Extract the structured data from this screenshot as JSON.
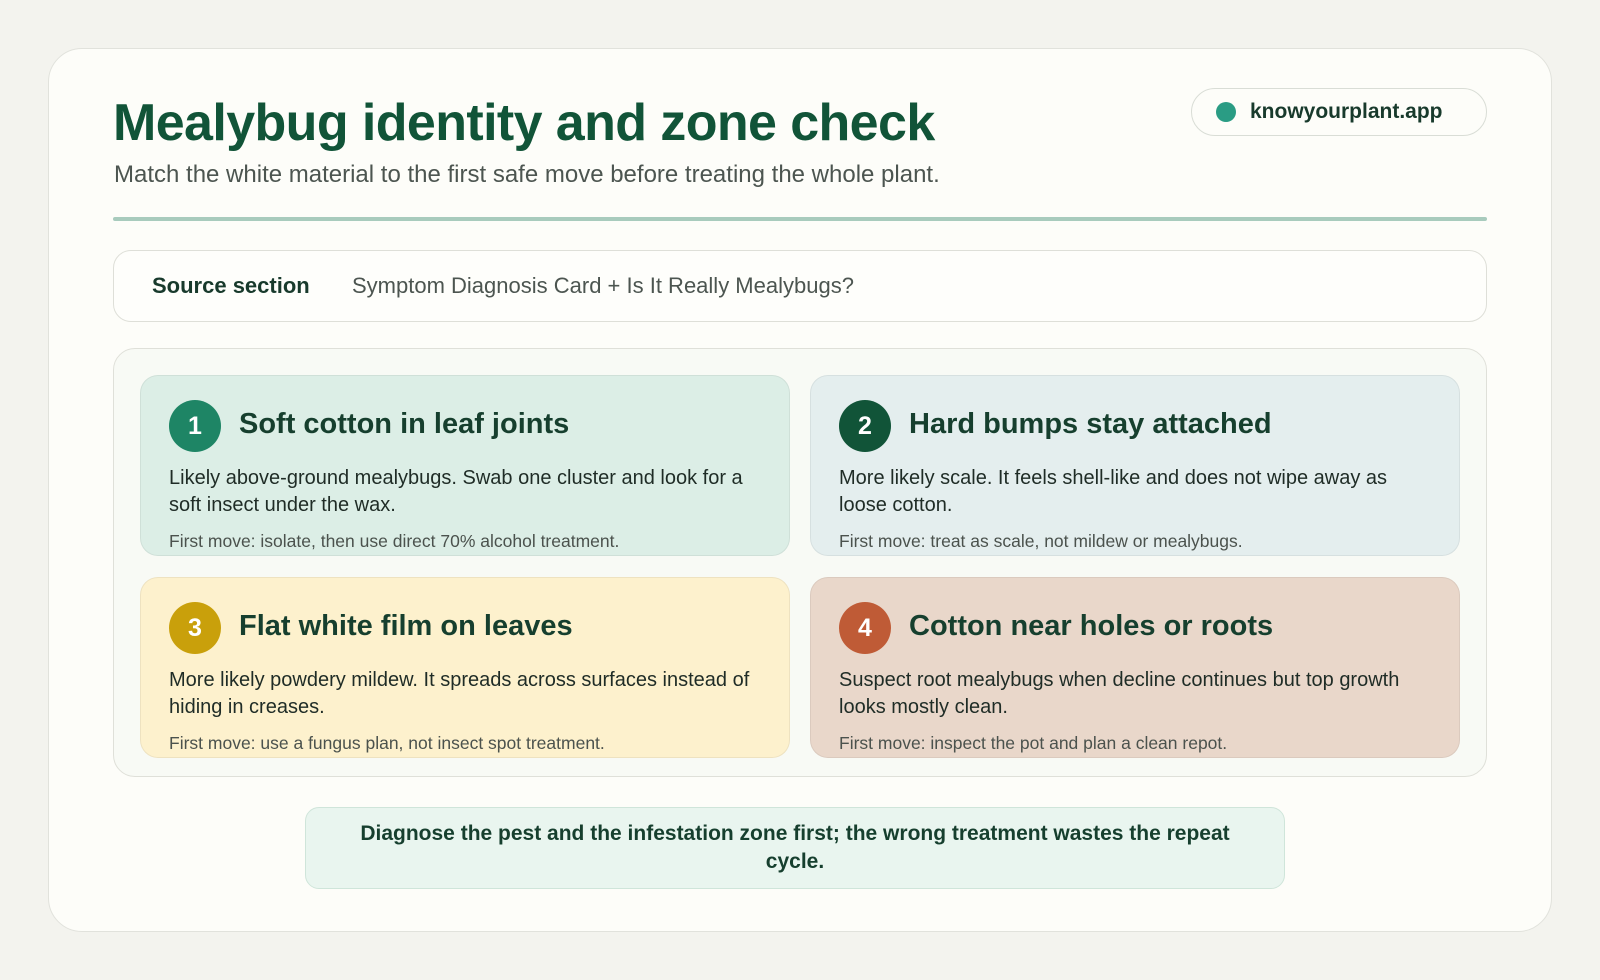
{
  "header": {
    "title": "Mealybug identity and zone check",
    "subtitle": "Match the white material to the first safe move before treating the whole plant.",
    "brand": "knowyourplant.app",
    "brand_dot_color": "#2a9c84"
  },
  "source": {
    "label": "Source section",
    "value": "Symptom Diagnosis Card + Is It Really Mealybugs?"
  },
  "cards": [
    {
      "number": "1",
      "title": "Soft cotton in leaf joints",
      "body": "Likely above-ground mealybugs. Swab one cluster and look for a soft insect under the wax.",
      "first_move": "First move: isolate, then use direct 70% alcohol treatment.",
      "badge_color": "#1e8565",
      "bg_color": "#dceee6"
    },
    {
      "number": "2",
      "title": "Hard bumps stay attached",
      "body": "More likely scale. It feels shell-like and does not wipe away as loose cotton.",
      "first_move": "First move: treat as scale, not mildew or mealybugs.",
      "badge_color": "#115438",
      "bg_color": "#e4eeee"
    },
    {
      "number": "3",
      "title": "Flat white film on leaves",
      "body": "More likely powdery mildew. It spreads across surfaces instead of hiding in creases.",
      "first_move": "First move: use a fungus plan, not insect spot treatment.",
      "badge_color": "#c9a00b",
      "bg_color": "#fdf1cd"
    },
    {
      "number": "4",
      "title": "Cotton near holes or roots",
      "body": "Suspect root mealybugs when decline continues but top growth looks mostly clean.",
      "first_move": "First move: inspect the pot and plan a clean repot.",
      "badge_color": "#bf5b36",
      "bg_color": "#e9d7ca"
    }
  ],
  "footer_note": "Diagnose the pest and the infestation zone first; the wrong treatment wastes the repeat cycle."
}
